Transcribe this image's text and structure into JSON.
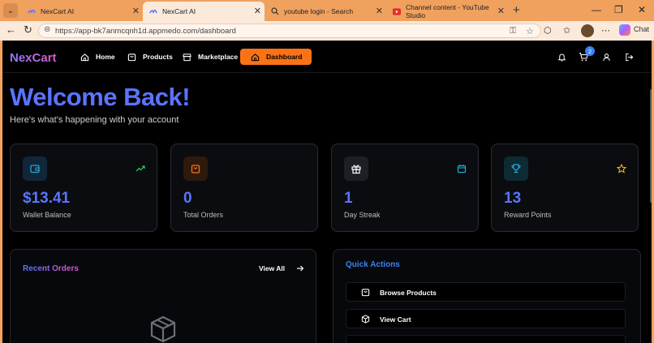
{
  "browser": {
    "tabs": [
      {
        "title": "NexCart AI",
        "active": false
      },
      {
        "title": "NexCart AI",
        "active": true
      },
      {
        "title": "youtube login - Search",
        "active": false
      },
      {
        "title": "Channel content - YouTube Studio",
        "active": false
      }
    ],
    "url": "https://app-bk7anmcqnh1d.appmedo.com/dashboard",
    "chat_label": "Chat"
  },
  "nav": {
    "brand": "NexCart",
    "links": [
      {
        "label": "Home",
        "icon": "home-icon"
      },
      {
        "label": "Products",
        "icon": "bag-icon"
      },
      {
        "label": "Marketplace",
        "icon": "store-icon"
      },
      {
        "label": "Dashboard",
        "icon": "home-icon",
        "active": true
      }
    ],
    "cart_count": "2"
  },
  "hero": {
    "title": "Welcome Back!",
    "subtitle": "Here's what's happening with your account"
  },
  "stats": [
    {
      "value": "$13.41",
      "label": "Wallet Balance",
      "icon": "wallet-icon",
      "side_icon": "trending-up-icon"
    },
    {
      "value": "0",
      "label": "Total Orders",
      "icon": "shopping-bag-icon",
      "side_icon": ""
    },
    {
      "value": "1",
      "label": "Day Streak",
      "icon": "gift-icon",
      "side_icon": "calendar-icon"
    },
    {
      "value": "13",
      "label": "Reward Points",
      "icon": "trophy-icon",
      "side_icon": "star-icon"
    }
  ],
  "recent_orders": {
    "title": "Recent Orders",
    "view_all": "View All"
  },
  "quick_actions": {
    "title": "Quick Actions",
    "items": [
      {
        "label": "Browse Products",
        "icon": "bag-icon"
      },
      {
        "label": "View Cart",
        "icon": "box-icon"
      }
    ]
  },
  "colors": {
    "accent": "#5a74ff",
    "orange": "#f97316",
    "green": "#22c55e",
    "cyan": "#22a9d6",
    "gold": "#eab308"
  }
}
